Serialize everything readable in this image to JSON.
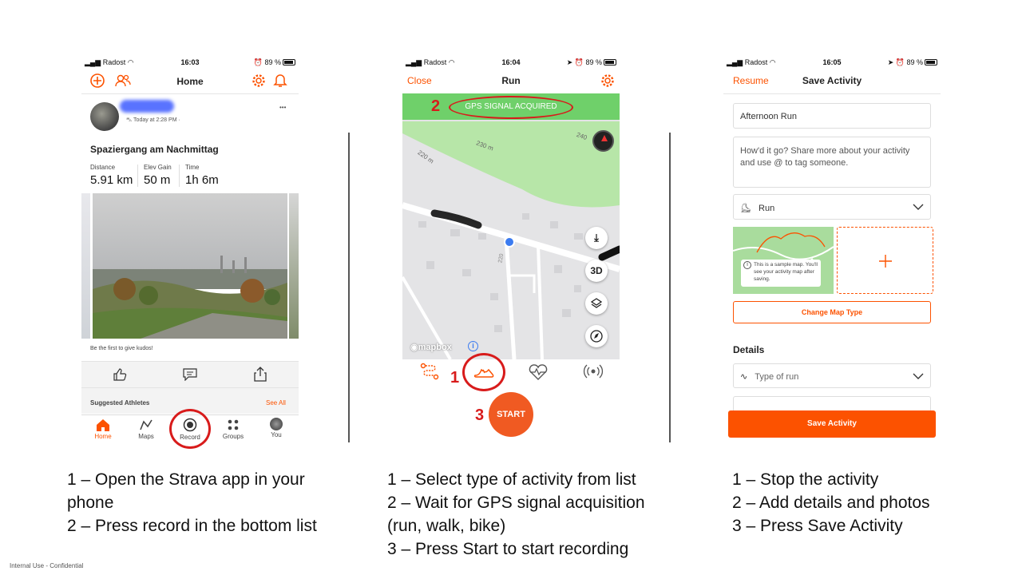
{
  "footer_note": "Internal Use - Confidential",
  "panel1": {
    "status": {
      "carrier": "Radost",
      "time": "16:03",
      "battery": "89 %"
    },
    "header_title": "Home",
    "post": {
      "timestamp": "Today at 2:28 PM ·",
      "title": "Spaziergang am Nachmittag",
      "stats": [
        {
          "label": "Distance",
          "value": "5.91 km"
        },
        {
          "label": "Elev Gain",
          "value": "50 m"
        },
        {
          "label": "Time",
          "value": "1h 6m"
        }
      ],
      "kudos_text": "Be the first to give kudos!",
      "more": "•••"
    },
    "suggested": {
      "label": "Suggested Athletes",
      "link": "See All"
    },
    "nav": [
      "Home",
      "Maps",
      "Record",
      "Groups",
      "You"
    ],
    "caption": [
      "1 – Open the Strava app in your",
      "phone",
      "2 – Press record in the bottom list"
    ]
  },
  "panel2": {
    "status": {
      "carrier": "Radost",
      "time": "16:04",
      "battery": "89 %"
    },
    "close": "Close",
    "title": "Run",
    "gps_banner": "GPS SIGNAL ACQUIRED",
    "map_labels": [
      "230 m",
      "220 m",
      "240",
      "220"
    ],
    "btn_3d": "3D",
    "mapbox": "mapbox",
    "start": "START",
    "markers": [
      "1",
      "2",
      "3"
    ],
    "caption": [
      "1 – Select type of activity from list",
      "2 – Wait for GPS signal acquisition",
      "(run, walk, bike)",
      "3 – Press Start to start recording"
    ]
  },
  "panel3": {
    "status": {
      "carrier": "Radost",
      "time": "16:05",
      "battery": "89 %"
    },
    "resume": "Resume",
    "title": "Save Activity",
    "name_value": "Afternoon Run",
    "desc_placeholder": "How'd it go? Share more about your activity and use @ to tag someone.",
    "sport": "Run",
    "map_note": "This is a sample map. You'll see your activity map after saving.",
    "change_map": "Change Map Type",
    "details_label": "Details",
    "type_of_run": "Type of run",
    "save_button": "Save Activity",
    "caption": [
      "1 – Stop the activity",
      "2 – Add details and photos",
      "3 – Press Save Activity"
    ]
  },
  "colors": {
    "accent": "#fc5200",
    "gps_green": "#6fd06a",
    "marker_red": "#d81b1b"
  }
}
